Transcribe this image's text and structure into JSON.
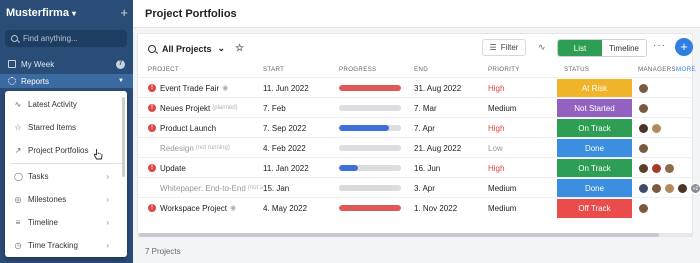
{
  "sidebar": {
    "brand": "Musterfirma",
    "find_placeholder": "Find anything...",
    "items": [
      {
        "label": "My Week",
        "badge": "7"
      },
      {
        "label": "Reports"
      }
    ],
    "dropdown": [
      {
        "label": "Latest Activity",
        "icon": "activity-icon"
      },
      {
        "label": "Starred Items",
        "icon": "star-icon"
      },
      {
        "label": "Project Portfolios",
        "icon": "chart-icon"
      },
      {
        "label": "Tasks",
        "icon": "check-circle-icon"
      },
      {
        "label": "Milestones",
        "icon": "milestone-icon"
      },
      {
        "label": "Timeline",
        "icon": "timeline-icon"
      },
      {
        "label": "Time Tracking",
        "icon": "clock-icon"
      }
    ]
  },
  "main": {
    "title": "Project Portfolios",
    "toolbar": {
      "view_title": "All Projects",
      "filter_label": "Filter",
      "list_label": "List",
      "timeline_label": "Timeline"
    },
    "columns": {
      "project": "PROJECT",
      "start": "START",
      "progress": "PROGRESS",
      "end": "END",
      "priority": "PRIORITY",
      "status": "STATUS",
      "managers": "MANAGERS",
      "more": "MORE"
    },
    "rows": [
      {
        "name": "Event Trade Fair",
        "note": "",
        "alert": true,
        "eye": true,
        "start": "11. Jun 2022",
        "progress": 1.0,
        "progress_color": "#e05757",
        "end": "31. Aug 2022",
        "priority": "High",
        "priority_class": "prio-high",
        "status": "At Risk",
        "status_color": "#f0b42a",
        "muted": false,
        "avatars": [
          "#7a5a3e"
        ]
      },
      {
        "name": "Neues Projekt",
        "note": "(planned)",
        "alert": true,
        "eye": false,
        "start": "7. Feb",
        "progress": 0.0,
        "progress_color": "#3f6fd8",
        "end": "7. Mar",
        "priority": "Medium",
        "priority_class": "",
        "status": "Not Started",
        "status_color": "#9361c0",
        "muted": false,
        "avatars": [
          "#7a5a3e"
        ]
      },
      {
        "name": "Product Launch",
        "note": "",
        "alert": true,
        "eye": false,
        "start": "7. Sep 2022",
        "progress": 0.8,
        "progress_color": "#3f6fd8",
        "end": "7. Apr",
        "priority": "High",
        "priority_class": "prio-high",
        "status": "On Track",
        "status_color": "#2e9e55",
        "muted": false,
        "avatars": [
          "#4a3226",
          "#b08a5a"
        ]
      },
      {
        "name": "Redesign",
        "note": "(not running)",
        "alert": false,
        "eye": false,
        "start": "4. Feb 2022",
        "progress": 0.0,
        "progress_color": "#3f6fd8",
        "end": "21. Aug 2022",
        "priority": "Low",
        "priority_class": "prio-low",
        "status": "Done",
        "status_color": "#3b8de0",
        "muted": true,
        "avatars": [
          "#7a5a3e"
        ]
      },
      {
        "name": "Update",
        "note": "",
        "alert": true,
        "eye": false,
        "start": "11. Jan 2022",
        "progress": 0.3,
        "progress_color": "#3f6fd8",
        "end": "16. Jun",
        "priority": "High",
        "priority_class": "prio-high",
        "status": "On Track",
        "status_color": "#2e9e55",
        "muted": false,
        "avatars": [
          "#5a3c2c",
          "#a33a2a",
          "#8a6a4a"
        ]
      },
      {
        "name": "Whitepaper: End-to-End",
        "note": "(not s",
        "alert": false,
        "eye": false,
        "start": "15. Jan",
        "progress": 0.85,
        "progress_color": "#d9d9d9",
        "end": "3. Apr",
        "priority": "Medium",
        "priority_class": "",
        "status": "Done",
        "status_color": "#3b8de0",
        "muted": true,
        "avatars": [
          "#3e4a6a",
          "#7a5a3e",
          "#b08a5a",
          "#4a3226"
        ],
        "extra": "+2"
      },
      {
        "name": "Workspace Project",
        "note": "",
        "alert": true,
        "eye": true,
        "start": "4. May 2022",
        "progress": 1.0,
        "progress_color": "#e05757",
        "end": "1. Nov 2022",
        "priority": "Medium",
        "priority_class": "",
        "status": "Off Track",
        "status_color": "#ea4b4b",
        "muted": false,
        "avatars": [
          "#7a5a3e"
        ]
      }
    ],
    "footer": "7 Projects"
  }
}
